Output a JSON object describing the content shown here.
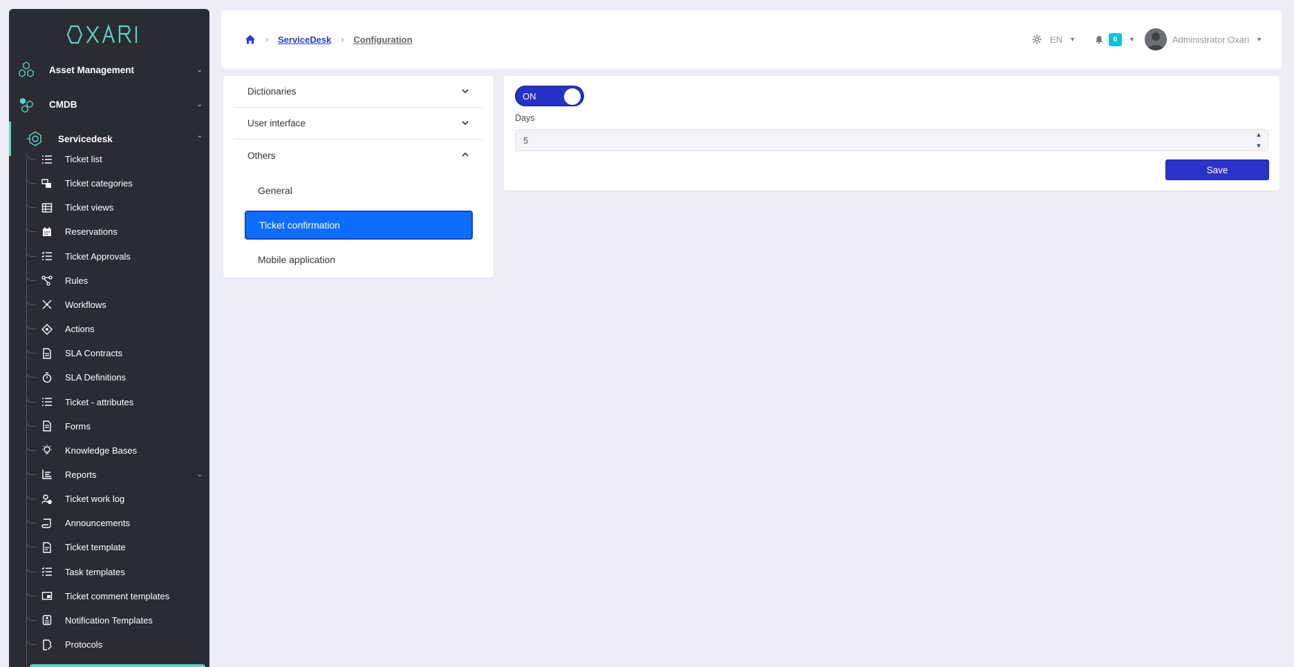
{
  "brand": {
    "logo_text": "OXARI",
    "accent": "#5fd3c8"
  },
  "sidebar": {
    "top_items": [
      {
        "label": "Asset Management",
        "icon": "hexagons-icon",
        "expanded": false
      },
      {
        "label": "CMDB",
        "icon": "hex-cluster-icon",
        "expanded": false
      },
      {
        "label": "Servicedesk",
        "icon": "servicedesk-icon",
        "expanded": true
      }
    ],
    "sub_items": [
      {
        "label": "Ticket list",
        "icon": "list-icon"
      },
      {
        "label": "Ticket categories",
        "icon": "categories-icon"
      },
      {
        "label": "Ticket views",
        "icon": "table-icon"
      },
      {
        "label": "Reservations",
        "icon": "calendar-icon"
      },
      {
        "label": "Ticket Approvals",
        "icon": "checklist-icon"
      },
      {
        "label": "Rules",
        "icon": "nodes-icon"
      },
      {
        "label": "Workflows",
        "icon": "workflow-icon"
      },
      {
        "label": "Actions",
        "icon": "target-icon"
      },
      {
        "label": "SLA Contracts",
        "icon": "document-icon"
      },
      {
        "label": "SLA Definitions",
        "icon": "stopwatch-icon"
      },
      {
        "label": "Ticket - attributes",
        "icon": "list-icon"
      },
      {
        "label": "Forms",
        "icon": "form-icon"
      },
      {
        "label": "Knowledge Bases",
        "icon": "lightbulb-icon"
      },
      {
        "label": "Reports",
        "icon": "chart-icon",
        "expandable": true
      },
      {
        "label": "Ticket work log",
        "icon": "user-clock-icon"
      },
      {
        "label": "Announcements",
        "icon": "scroll-icon"
      },
      {
        "label": "Ticket template",
        "icon": "file-icon"
      },
      {
        "label": "Task templates",
        "icon": "checklist-icon"
      },
      {
        "label": "Ticket comment templates",
        "icon": "comment-template-icon"
      },
      {
        "label": "Notification Templates",
        "icon": "notification-template-icon"
      },
      {
        "label": "Protocols",
        "icon": "signature-icon"
      }
    ]
  },
  "header": {
    "breadcrumb": {
      "home_icon": "home-icon",
      "item1": "ServiceDesk",
      "item2": "Configuration"
    },
    "language": "EN",
    "notifications_count": "0",
    "user_name": "Administrator Oxari"
  },
  "config_menu": {
    "sections": [
      {
        "label": "Dictionaries",
        "expanded": false
      },
      {
        "label": "User interface",
        "expanded": false
      },
      {
        "label": "Others",
        "expanded": true
      }
    ],
    "others_items": [
      {
        "label": "General",
        "selected": false
      },
      {
        "label": "Ticket confirmation",
        "selected": true
      },
      {
        "label": "Mobile application",
        "selected": false
      }
    ]
  },
  "main": {
    "toggle_label": "ON",
    "toggle_on": true,
    "days_label": "Days",
    "days_value": "5",
    "save_label": "Save"
  },
  "colors": {
    "primary": "#2b33c9",
    "selected": "#0d6efd",
    "sidebar_bg": "#2a2c33",
    "badge": "#12c0dc"
  }
}
